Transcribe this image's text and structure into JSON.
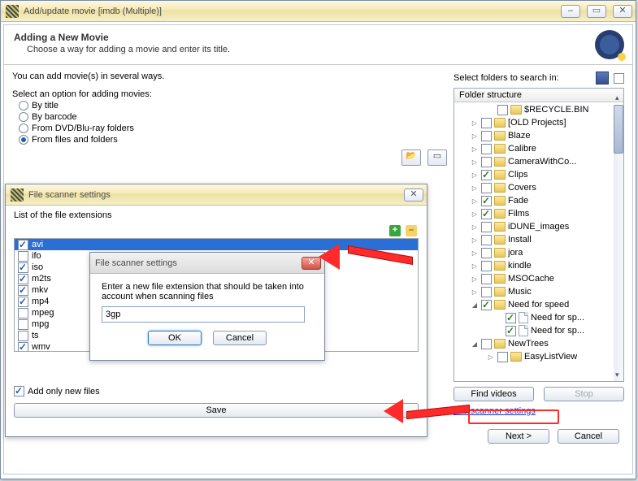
{
  "main_window": {
    "title": "Add/update movie [imdb (Multiple)]"
  },
  "header": {
    "title": "Adding a New Movie",
    "subtitle": "Choose a way for adding a movie and enter its title."
  },
  "left": {
    "intro": "You can add movie(s) in several ways.",
    "options_label": "Select an option for adding movies:",
    "options": [
      {
        "label": "By title",
        "selected": false
      },
      {
        "label": "By barcode",
        "selected": false
      },
      {
        "label": "From DVD/Blu-ray folders",
        "selected": false
      },
      {
        "label": "From files and folders",
        "selected": true
      }
    ]
  },
  "right": {
    "panel_label": "Select folders to search in:",
    "tree_header": "Folder structure",
    "find_label": "Find videos",
    "stop_label": "Stop",
    "scanner_link": "File scanner settings",
    "tree": [
      {
        "ind": 4,
        "exp": "",
        "chk": "",
        "ico": "folder",
        "label": "$RECYCLE.BIN"
      },
      {
        "ind": 2,
        "exp": "▷",
        "chk": "",
        "ico": "folder",
        "label": "[OLD Projects]"
      },
      {
        "ind": 2,
        "exp": "▷",
        "chk": "",
        "ico": "folder",
        "label": "Blaze"
      },
      {
        "ind": 2,
        "exp": "▷",
        "chk": "",
        "ico": "folder",
        "label": "Calibre"
      },
      {
        "ind": 2,
        "exp": "▷",
        "chk": "",
        "ico": "folder",
        "label": "CameraWithCo..."
      },
      {
        "ind": 2,
        "exp": "▷",
        "chk": "g",
        "ico": "folder",
        "label": "Clips"
      },
      {
        "ind": 2,
        "exp": "▷",
        "chk": "",
        "ico": "folder",
        "label": "Covers"
      },
      {
        "ind": 2,
        "exp": "▷",
        "chk": "g",
        "ico": "folder",
        "label": "Fade"
      },
      {
        "ind": 2,
        "exp": "▷",
        "chk": "g",
        "ico": "folder",
        "label": "Films"
      },
      {
        "ind": 2,
        "exp": "▷",
        "chk": "",
        "ico": "folder",
        "label": "iDUNE_images"
      },
      {
        "ind": 2,
        "exp": "▷",
        "chk": "",
        "ico": "folder",
        "label": "Install"
      },
      {
        "ind": 2,
        "exp": "▷",
        "chk": "",
        "ico": "folder",
        "label": "jora"
      },
      {
        "ind": 2,
        "exp": "▷",
        "chk": "",
        "ico": "folder",
        "label": "kindle"
      },
      {
        "ind": 2,
        "exp": "▷",
        "chk": "",
        "ico": "folder",
        "label": "MSOCache"
      },
      {
        "ind": 2,
        "exp": "▷",
        "chk": "",
        "ico": "folder",
        "label": "Music"
      },
      {
        "ind": 2,
        "exp": "◢",
        "chk": "g",
        "ico": "folder",
        "label": "Need for speed"
      },
      {
        "ind": 5,
        "exp": "",
        "chk": "g",
        "ico": "page",
        "label": "Need for sp..."
      },
      {
        "ind": 5,
        "exp": "",
        "chk": "g",
        "ico": "page",
        "label": "Need for sp..."
      },
      {
        "ind": 2,
        "exp": "◢",
        "chk": "",
        "ico": "folder",
        "label": "NewTrees"
      },
      {
        "ind": 4,
        "exp": "▷",
        "chk": "",
        "ico": "folder",
        "label": "EasyListView"
      }
    ]
  },
  "footer": {
    "next": "Next >",
    "cancel": "Cancel"
  },
  "scanner_window": {
    "title": "File scanner settings",
    "list_label": "List of the file extensions",
    "extensions": [
      {
        "ext": "avi",
        "checked": true,
        "selected": true
      },
      {
        "ext": "ifo",
        "checked": false
      },
      {
        "ext": "iso",
        "checked": true
      },
      {
        "ext": "m2ts",
        "checked": true
      },
      {
        "ext": "mkv",
        "checked": true
      },
      {
        "ext": "mp4",
        "checked": true
      },
      {
        "ext": "mpeg",
        "checked": false
      },
      {
        "ext": "mpg",
        "checked": false
      },
      {
        "ext": "ts",
        "checked": false
      },
      {
        "ext": "wmv",
        "checked": true
      }
    ],
    "add_only_label": "Add only new files",
    "add_only_checked": true,
    "save_label": "Save"
  },
  "input_dialog": {
    "title": "File scanner settings",
    "prompt": "Enter a new file extension that should be taken into account when scanning files",
    "value": "3gp",
    "ok": "OK",
    "cancel": "Cancel"
  }
}
